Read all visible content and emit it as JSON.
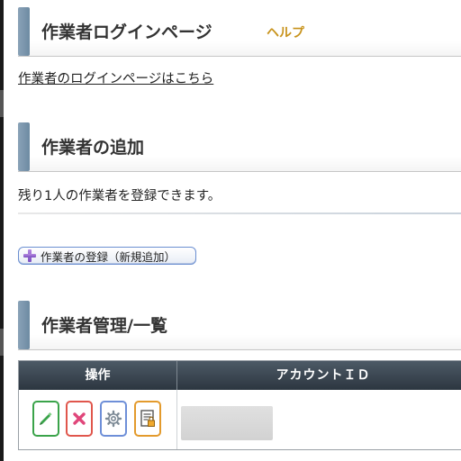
{
  "login_section": {
    "title": "作業者ログインページ",
    "help_label": "ヘルプ",
    "login_link": "作業者のログインページはこちら"
  },
  "add_section": {
    "title": "作業者の追加",
    "remaining_text": "残り1人の作業者を登録できます。",
    "register_button_label": "作業者の登録（新規追加）",
    "register_icon": "plus-icon"
  },
  "manage_section": {
    "title": "作業者管理/一覧",
    "table": {
      "columns": [
        "操作",
        "アカウントＩＤ"
      ],
      "rows": [
        {
          "actions": [
            "edit-icon",
            "delete-icon",
            "settings-icon",
            "document-icon"
          ],
          "account_id": ""
        }
      ]
    }
  },
  "colors": {
    "header_bar": "#7a94ab",
    "help_link": "#c8931c",
    "table_header": "#3a4651",
    "edit": "#3aa34a",
    "delete": "#e0564c",
    "settings": "#6e8fd8",
    "document": "#e39a2c"
  }
}
